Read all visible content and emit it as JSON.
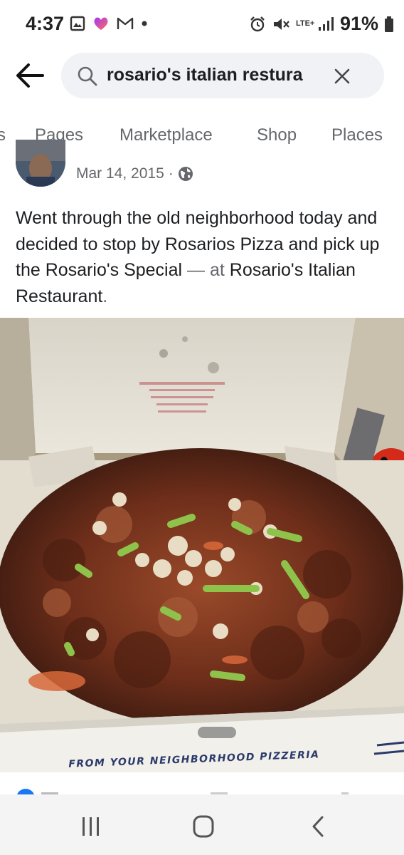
{
  "status_bar": {
    "time": "4:37",
    "battery": "91%",
    "network": "LTE+",
    "left_icons": [
      "gallery-icon",
      "messenger-icon",
      "gmail-icon",
      "notification-dot"
    ],
    "right_icons": [
      "alarm-icon",
      "mute-icon",
      "lte-icon",
      "signal-icon",
      "battery-icon"
    ]
  },
  "search": {
    "query": "rosario's italian restura",
    "back_icon": "arrow-left-icon",
    "search_icon": "search-icon",
    "clear_icon": "close-icon"
  },
  "tabs": [
    {
      "label": "s"
    },
    {
      "label": "Pages"
    },
    {
      "label": "Marketplace"
    },
    {
      "label": "Shop"
    },
    {
      "label": "Places"
    }
  ],
  "post": {
    "date": "Mar 14, 2015",
    "separator": "·",
    "privacy_icon": "globe-icon",
    "text_main": "Went through the old neighborhood today and decided to stop by Rosarios Pizza and pick up the Rosario's Special",
    "text_dash": " — ",
    "text_at": "at",
    "text_place": " Rosario's Italian Restaurant",
    "text_period": ".",
    "box_print": "FROM YOUR NEIGHBORHOOD PIZZERIA"
  },
  "nav": {
    "recent_icon": "recent-apps-icon",
    "home_icon": "home-icon",
    "back_icon": "back-chevron-icon"
  },
  "colors": {
    "text": "#1c1e21",
    "muted": "#65676b",
    "search_bg": "#f0f2f5",
    "nav_bg": "#f4f4f4",
    "like_blue": "#1877f2"
  }
}
